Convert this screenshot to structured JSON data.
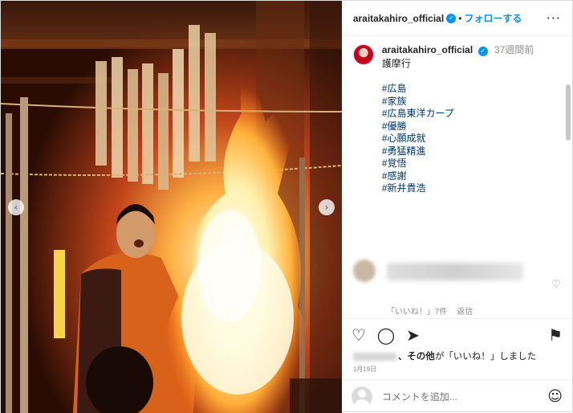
{
  "header": {
    "username": "araitakahiro_official",
    "verified_glyph": "✓",
    "separator": "•",
    "follow_label": "フォローする",
    "more_glyph": "···"
  },
  "caption": {
    "username": "araitakahiro_official",
    "verified_glyph": "✓",
    "ago": "37週間前",
    "title": "護摩行",
    "hashtags": [
      "#広島",
      "#家族",
      "#広島東洋カープ",
      "#優勝",
      "#心願成就",
      "#勇猛精進",
      "#覚悟",
      "#感謝",
      "#新井貴浩"
    ]
  },
  "comment": {
    "likes_label": "「いいね！」7件",
    "reply_label": "返信",
    "heart_glyph": "♡"
  },
  "actions": {
    "like_glyph": "♡",
    "comment_glyph": "◯",
    "share_glyph": "➤",
    "save_glyph": "⚑"
  },
  "liked_by": {
    "others_label": "、その他",
    "suffix_label": "が「いいね！」しました"
  },
  "date": "1月19日",
  "add_comment": {
    "placeholder": "コメントを追加...",
    "emoji_glyph": "☺"
  },
  "media": {
    "prev_glyph": "‹",
    "next_glyph": "›",
    "fire_color": "#ffb347",
    "robe_color": "#d9621a"
  }
}
